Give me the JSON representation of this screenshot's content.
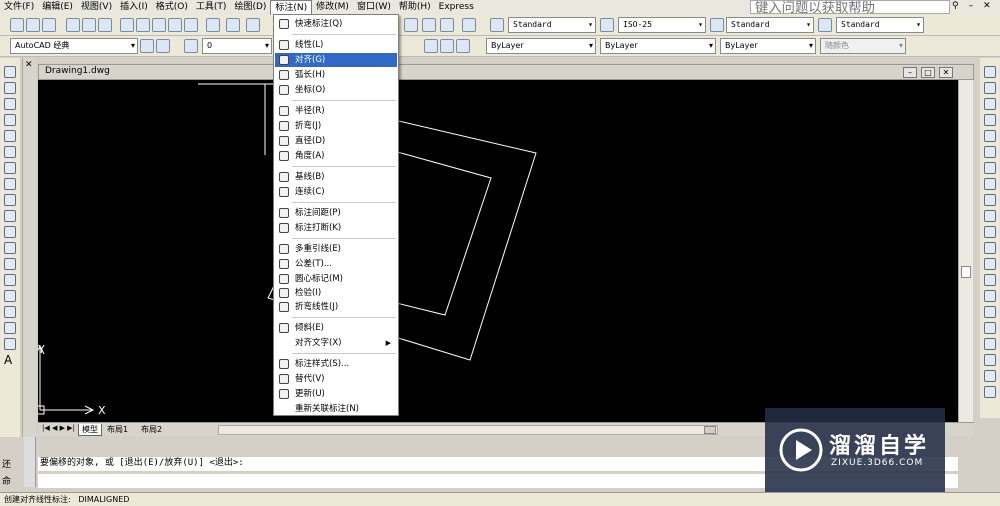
{
  "menubar": {
    "items": [
      "文件(F)",
      "编辑(E)",
      "视图(V)",
      "插入(I)",
      "格式(O)",
      "工具(T)",
      "绘图(D)",
      "标注(N)",
      "修改(M)",
      "窗口(W)",
      "帮助(H)",
      "Express"
    ],
    "help_placeholder": "键入问题以获取帮助"
  },
  "toolbar1": {
    "text_style": "Standard",
    "dim_style": "ISO-25",
    "table_style": "Standard",
    "multileader_style": "Standard"
  },
  "toolbar2": {
    "workspace": "AutoCAD 经典",
    "layer": "0",
    "color": "ByLayer",
    "linetype": "ByLayer",
    "lineweight": "ByLayer",
    "plotstyle": "随颜色"
  },
  "drawing": {
    "title": "Drawing1.dwg",
    "axis_y": "Y",
    "axis_x": "X"
  },
  "layout_tabs": [
    "模型",
    "布局1",
    "布局2"
  ],
  "dim_menu": {
    "items": [
      {
        "label": "快速标注(Q)",
        "icon": "quick-dimension-icon"
      },
      {
        "label": "线性(L)",
        "icon": "linear-dimension-icon"
      },
      {
        "label": "对齐(G)",
        "icon": "aligned-dimension-icon"
      },
      {
        "label": "弧长(H)",
        "icon": "arc-length-icon"
      },
      {
        "label": "坐标(O)",
        "icon": "ordinate-icon"
      },
      {
        "label": "半径(R)",
        "icon": "radius-icon"
      },
      {
        "label": "折弯(J)",
        "icon": "jogged-icon"
      },
      {
        "label": "直径(D)",
        "icon": "diameter-icon"
      },
      {
        "label": "角度(A)",
        "icon": "angular-icon"
      },
      {
        "label": "基线(B)",
        "icon": "baseline-icon"
      },
      {
        "label": "连续(C)",
        "icon": "continue-icon"
      },
      {
        "label": "标注间距(P)",
        "icon": "dimension-space-icon"
      },
      {
        "label": "标注打断(K)",
        "icon": "dimension-break-icon"
      },
      {
        "label": "多重引线(E)",
        "icon": "multileader-icon"
      },
      {
        "label": "公差(T)...",
        "icon": "tolerance-icon"
      },
      {
        "label": "圆心标记(M)",
        "icon": "center-mark-icon"
      },
      {
        "label": "检验(I)",
        "icon": "inspection-icon"
      },
      {
        "label": "折弯线性(J)",
        "icon": "jogged-linear-icon"
      },
      {
        "label": "倾斜(E)",
        "icon": "oblique-icon"
      },
      {
        "label": "对齐文字(X)",
        "icon": ""
      },
      {
        "label": "标注样式(S)...",
        "icon": "dimension-style-icon"
      },
      {
        "label": "替代(V)",
        "icon": "override-icon"
      },
      {
        "label": "更新(U)",
        "icon": "update-icon"
      },
      {
        "label": "重新关联标注(N)",
        "icon": ""
      }
    ]
  },
  "command": {
    "line1_prefix": "还",
    "line1": "要偏移的对象, 或 [退出(E)/放弃(U)] <退出>:",
    "line2_prefix": "命",
    "line2": ""
  },
  "status": {
    "text": "创建对齐线性标注:   DIMALIGNED"
  },
  "watermark": {
    "brand": "溜溜自学",
    "url": "ZIXUE.3D66.COM"
  }
}
